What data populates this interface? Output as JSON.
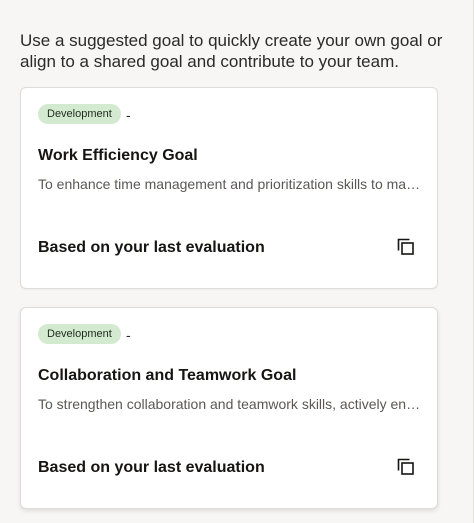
{
  "intro_text": "Use a suggested goal to quickly create your own goal or align to a shared goal and contribute to your team.",
  "goals": [
    {
      "category": "Development",
      "separator": "-",
      "title": "Work Efficiency Goal",
      "description": "To enhance time management and prioritization skills to maximize productivity",
      "basis": "Based on your last evaluation",
      "action_icon": "copy-icon"
    },
    {
      "category": "Development",
      "separator": "-",
      "title": "Collaboration and Teamwork Goal",
      "description": "To strengthen collaboration and teamwork skills, actively engaging with colleagues",
      "basis": "Based on your last evaluation",
      "action_icon": "copy-icon"
    }
  ],
  "colors": {
    "badge_bg": "#d4ead0",
    "card_bg": "#ffffff",
    "page_bg": "#f7f6f4",
    "text_primary": "#161513",
    "text_secondary": "#5a5855"
  }
}
